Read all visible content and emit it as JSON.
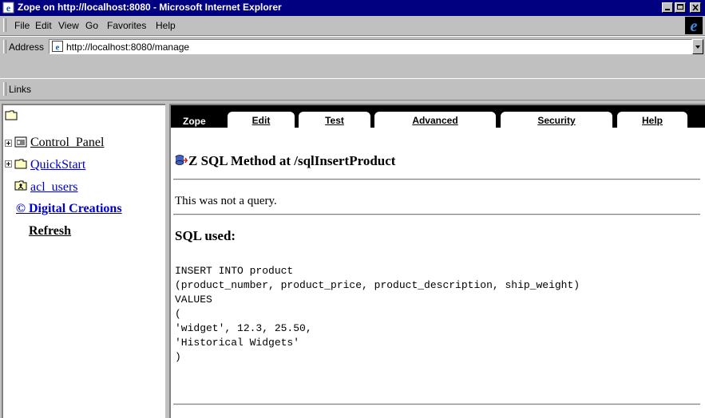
{
  "window": {
    "title": "Zope on http://localhost:8080 - Microsoft Internet Explorer"
  },
  "menu": {
    "items": [
      {
        "label": "File"
      },
      {
        "label": "Edit"
      },
      {
        "label": "View"
      },
      {
        "label": "Go"
      },
      {
        "label": "Favorites"
      },
      {
        "label": "Help"
      }
    ]
  },
  "address": {
    "label": "Address",
    "url": "http://localhost:8080/manage"
  },
  "links": {
    "label": "Links"
  },
  "tree": {
    "items": [
      {
        "label": "Control_Panel",
        "icon": "control-panel-icon",
        "expandable": true
      },
      {
        "label": "QuickStart",
        "icon": "folder-icon",
        "expandable": true
      },
      {
        "label": "acl_users",
        "icon": "user-folder-icon",
        "expandable": false
      }
    ],
    "digital_creations": "© Digital Creations",
    "refresh": "Refresh"
  },
  "tabs": {
    "brand": "Zope",
    "items": [
      {
        "label": "Edit"
      },
      {
        "label": "Test"
      },
      {
        "label": "Advanced"
      },
      {
        "label": "Security"
      },
      {
        "label": "Help"
      }
    ]
  },
  "main": {
    "heading": "Z SQL Method at /sqlInsertProduct",
    "message": "This was not a query.",
    "sql_title": "SQL used:",
    "sql_code": "INSERT INTO product\n(product_number, product_price, product_description, ship_weight)\nVALUES\n(\n'widget', 12.3, 25.50,\n'Historical Widgets'\n)"
  },
  "colors": {
    "titlebar": "#000080",
    "chrome": "#c0c0c0",
    "tabstrip": "#000000",
    "link": "#0000cc"
  }
}
